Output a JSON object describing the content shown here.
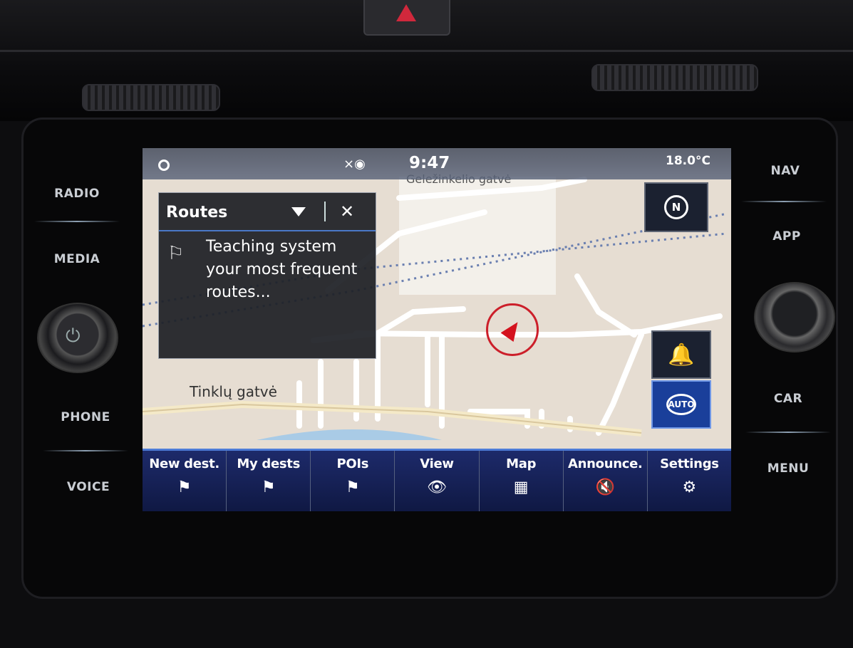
{
  "hard_buttons": {
    "radio": "RADIO",
    "media": "MEDIA",
    "phone": "PHONE",
    "voice": "VOICE",
    "nav": "NAV",
    "app": "APP",
    "car": "CAR",
    "menu": "MENU"
  },
  "status": {
    "time": "9:47",
    "temperature": "18.0°C",
    "gps_icon": "gps-signal-off-icon"
  },
  "map": {
    "street_top": "Geležinkelio gatvė",
    "street_bottom": "Tinklų gatvė",
    "compass_label": "N",
    "auto_label": "AUTO"
  },
  "popup": {
    "title": "Routes",
    "message": "Teaching system your most frequent routes..."
  },
  "menu": {
    "items": [
      {
        "label": "New dest.",
        "icon": "⚑"
      },
      {
        "label": "My dests",
        "icon": "⚑"
      },
      {
        "label": "POIs",
        "icon": "⚑"
      },
      {
        "label": "View",
        "icon": "👁"
      },
      {
        "label": "Map",
        "icon": "▦"
      },
      {
        "label": "Announce.",
        "icon": "🔇"
      },
      {
        "label": "Settings",
        "icon": "⚙"
      }
    ]
  },
  "colors": {
    "menu_bar": "#1d2a6a",
    "accent_blue": "#4d7bd6",
    "position_red": "#cc1f2a",
    "map_background": "#e6ddd2"
  }
}
